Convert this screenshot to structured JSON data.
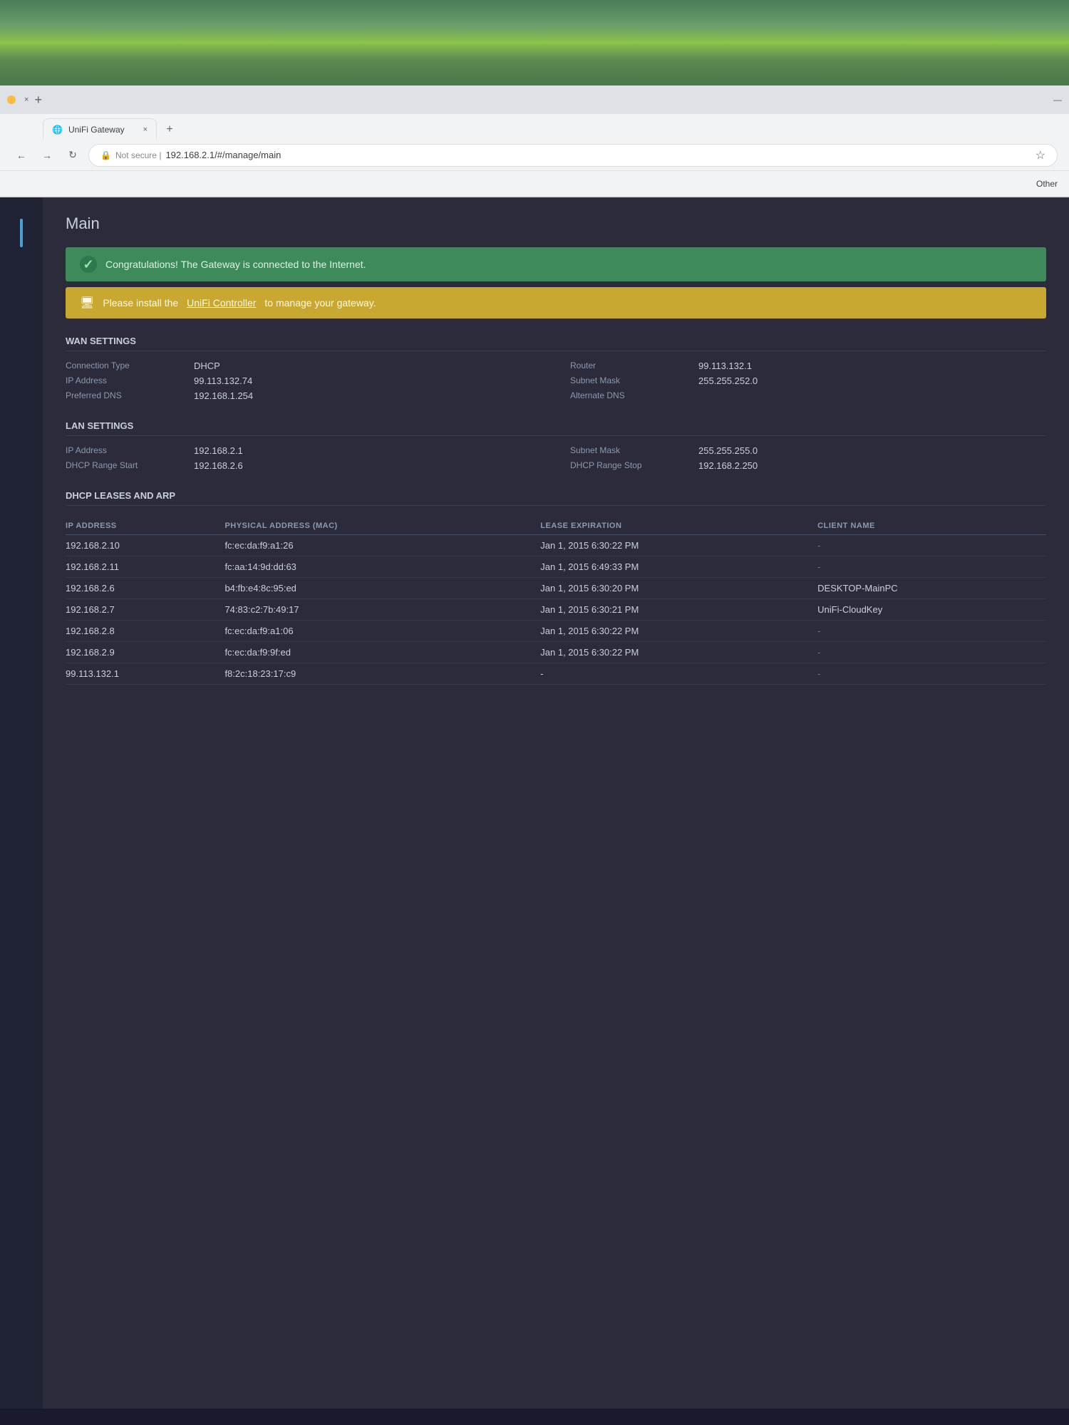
{
  "browser": {
    "tab_label": "UniFi Gateway",
    "tab_close": "×",
    "tab_plus": "+",
    "address": "192.168.2.1/#/manage/main",
    "address_prefix": "Not secure  |",
    "star_label": "☆",
    "other_bookmarks": "Other",
    "minimize": "—"
  },
  "page": {
    "title": "Main",
    "banner_success": "Congratulations! The Gateway is connected to the Internet.",
    "banner_warning_prefix": "Please install the ",
    "banner_warning_link": "UniFi Controller",
    "banner_warning_suffix": " to manage your gateway.",
    "check_icon": "✓",
    "monitor_icon": "⊟"
  },
  "wan_settings": {
    "header": "WAN SETTINGS",
    "connection_type_label": "Connection Type",
    "connection_type_value": "DHCP",
    "ip_address_label": "IP Address",
    "ip_address_value": "99.113.132.74",
    "preferred_dns_label": "Preferred DNS",
    "preferred_dns_value": "192.168.1.254",
    "router_label": "Router",
    "router_value": "99.113.132.1",
    "subnet_mask_label": "Subnet Mask",
    "subnet_mask_value": "255.255.252.0",
    "alternate_dns_label": "Alternate DNS",
    "alternate_dns_value": ""
  },
  "lan_settings": {
    "header": "LAN SETTINGS",
    "ip_address_label": "IP Address",
    "ip_address_value": "192.168.2.1",
    "dhcp_range_start_label": "DHCP Range Start",
    "dhcp_range_start_value": "192.168.2.6",
    "subnet_mask_label": "Subnet Mask",
    "subnet_mask_value": "255.255.255.0",
    "dhcp_range_stop_label": "DHCP Range Stop",
    "dhcp_range_stop_value": "192.168.2.250"
  },
  "dhcp_leases": {
    "header": "DHCP LEASES AND ARP",
    "columns": [
      "IP ADDRESS",
      "PHYSICAL ADDRESS (MAC)",
      "LEASE EXPIRATION",
      "CLIENT NAME"
    ],
    "rows": [
      {
        "ip": "192.168.2.10",
        "mac": "fc:ec:da:f9:a1:26",
        "lease": "Jan 1, 2015 6:30:22 PM",
        "client": "-"
      },
      {
        "ip": "192.168.2.11",
        "mac": "fc:aa:14:9d:dd:63",
        "lease": "Jan 1, 2015 6:49:33 PM",
        "client": "-"
      },
      {
        "ip": "192.168.2.6",
        "mac": "b4:fb:e4:8c:95:ed",
        "lease": "Jan 1, 2015 6:30:20 PM",
        "client": "DESKTOP-MainPC"
      },
      {
        "ip": "192.168.2.7",
        "mac": "74:83:c2:7b:49:17",
        "lease": "Jan 1, 2015 6:30:21 PM",
        "client": "UniFi-CloudKey"
      },
      {
        "ip": "192.168.2.8",
        "mac": "fc:ec:da:f9:a1:06",
        "lease": "Jan 1, 2015 6:30:22 PM",
        "client": "-"
      },
      {
        "ip": "192.168.2.9",
        "mac": "fc:ec:da:f9:9f:ed",
        "lease": "Jan 1, 2015 6:30:22 PM",
        "client": "-"
      },
      {
        "ip": "99.113.132.1",
        "mac": "f8:2c:18:23:17:c9",
        "lease": "-",
        "client": "-"
      }
    ]
  }
}
